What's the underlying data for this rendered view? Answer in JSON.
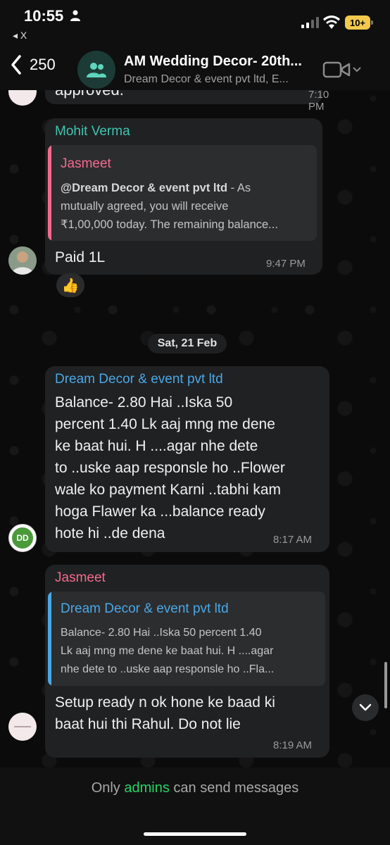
{
  "status_bar": {
    "time": "10:55",
    "back_app": "◂ X",
    "battery": "10+"
  },
  "header": {
    "unread_count": "250",
    "group_name": "AM Wedding Decor- 20th...",
    "group_subtitle": "Dream Decor & event pvt ltd, E..."
  },
  "messages": [
    {
      "partial_text": "approved.",
      "time": "7:10 PM"
    },
    {
      "sender": "Mohit Verma",
      "sender_color": "#3fc5b0",
      "quote": {
        "author": "Jasmeet",
        "author_color": "#f46a8c",
        "mention": "@Dream Decor & event pvt ltd",
        "text_line1_rest": " - As",
        "text_line2": "mutually agreed, you will receive",
        "text_line3": "₹1,00,000 today. The remaining balance..."
      },
      "text": "Paid 1L",
      "time": "9:47 PM",
      "reaction": "👍"
    },
    {
      "sender": "Dream Decor & event pvt ltd",
      "sender_color": "#4aa8e6",
      "lines": [
        "Balance- 2.80 Hai ..Iska 50",
        "percent 1.40 Lk  aaj mng me dene",
        "ke baat hui. H ....agar nhe dete",
        "to ..uske aap responsle ho ..Flower",
        "wale ko payment Karni ..tabhi kam",
        "hoga Flawer ka ...balance ready",
        "hote hi ..de dena"
      ],
      "time": "8:17 AM",
      "avatar_text": "DD"
    },
    {
      "sender": "Jasmeet",
      "sender_color": "#f46a8c",
      "quote": {
        "author": "Dream Decor & event pvt ltd",
        "author_color": "#4aa8e6",
        "lines": [
          "Balance- 2.80 Hai ..Iska 50 percent 1.40",
          "Lk  aaj mng me dene ke baat hui. H ....agar",
          "nhe dete to ..uske aap responsle ho ..Fla..."
        ]
      },
      "lines": [
        "Setup ready n ok hone ke baad ki",
        "baat hui thi Rahul. Do not lie"
      ],
      "time": "8:19 AM"
    }
  ],
  "date_separator": "Sat, 21 Feb",
  "footer": {
    "prefix": "Only ",
    "admins": "admins",
    "suffix": " can send messages"
  },
  "colors": {
    "accent_green": "#25d366",
    "bubble": "#202123",
    "quote_bg": "#2c2d2f"
  }
}
